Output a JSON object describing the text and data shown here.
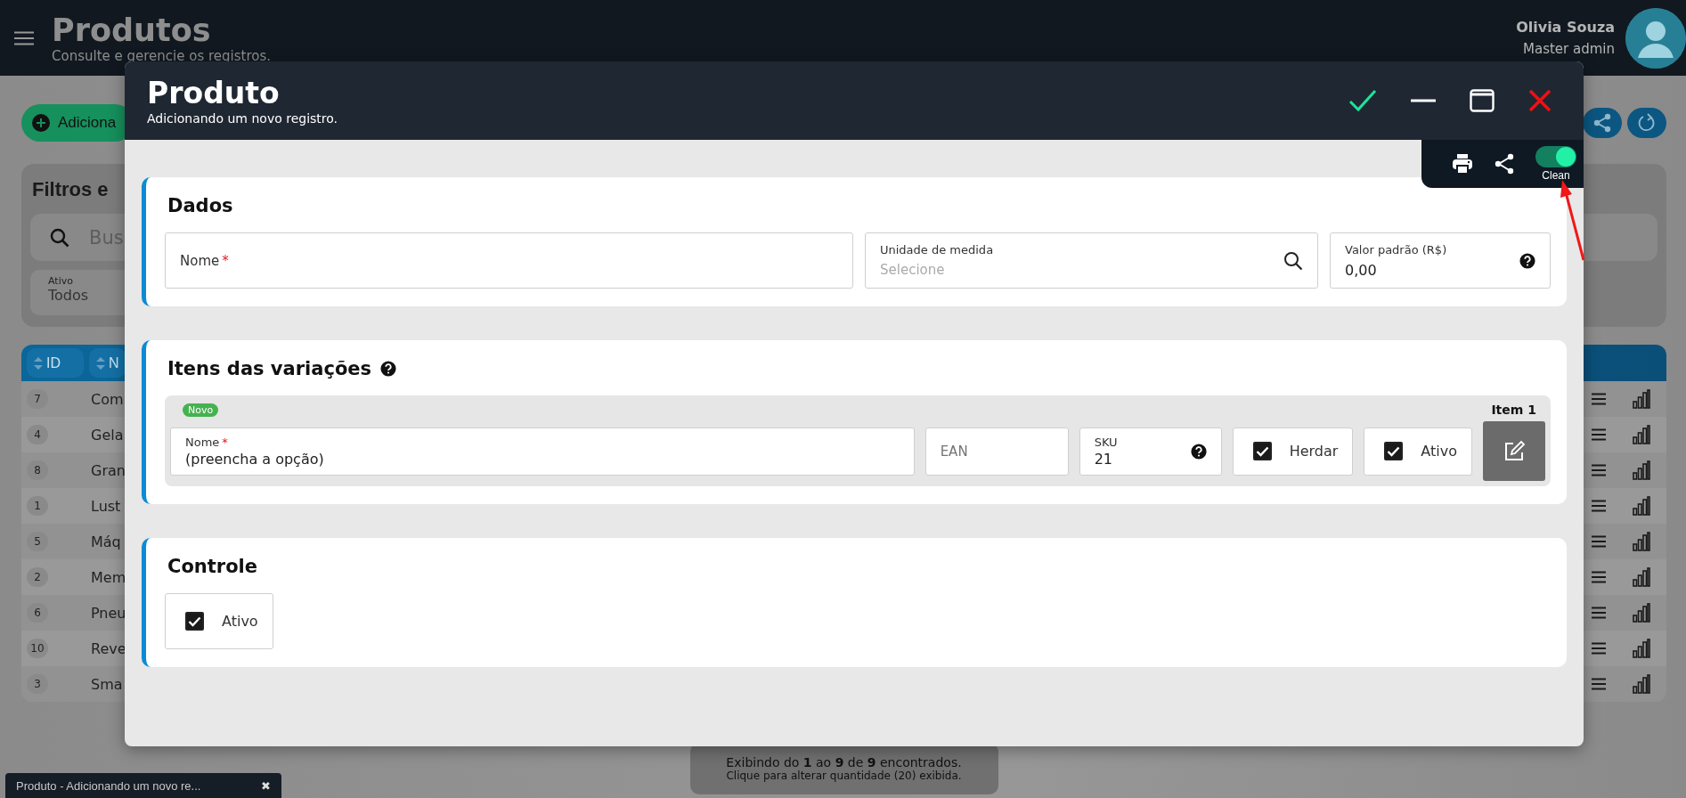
{
  "header": {
    "title": "Produtos",
    "subtitle": "Consulte e gerencie os registros.",
    "user": {
      "name": "Olivia Souza",
      "role": "Master admin"
    }
  },
  "toolbar": {
    "add_button": "Adiciona"
  },
  "filters": {
    "title": "Filtros e",
    "search_placeholder": "Bus",
    "active_field": {
      "label": "Ativo",
      "value": "Todos"
    }
  },
  "table": {
    "columns": [
      "ID",
      "N"
    ],
    "rows": [
      {
        "id": "7",
        "name": "Com"
      },
      {
        "id": "4",
        "name": "Gela"
      },
      {
        "id": "8",
        "name": "Gran"
      },
      {
        "id": "1",
        "name": "Lust"
      },
      {
        "id": "5",
        "name": "Máq"
      },
      {
        "id": "2",
        "name": "Mem"
      },
      {
        "id": "6",
        "name": "Pneu"
      },
      {
        "id": "10",
        "name": "Reve"
      },
      {
        "id": "3",
        "name": "Sma"
      }
    ]
  },
  "pagination": {
    "summary": "Exibindo do **1** ao **9** de **9** encontrados.",
    "hint": "Clique para alterar quantidade (20) exibida."
  },
  "taskbar": [
    {
      "label": "Produto - Adicionando um novo re...",
      "close": "✖"
    }
  ],
  "dialog": {
    "title": "Produto",
    "subtitle": "Adicionando um novo registro.",
    "clean_toggle": {
      "label": "Clean",
      "on": true
    },
    "sections": [
      {
        "kind": "fields",
        "title": "Dados",
        "fields": [
          {
            "kind": "text",
            "label": "Nome",
            "required_mark": "*"
          },
          {
            "kind": "lookup",
            "label": "Unidade de medida",
            "placeholder": "Selecione"
          },
          {
            "kind": "help",
            "label": "Valor padrão (R$)",
            "value": "0,00"
          }
        ]
      },
      {
        "kind": "variations",
        "title": "Itens das variações",
        "items": [
          {
            "badge": "Novo",
            "label": "Item 1",
            "name": {
              "label": "Nome",
              "required_mark": "*",
              "value": "(preencha a opção)"
            },
            "ean": {
              "placeholder": "EAN"
            },
            "sku": {
              "label": "SKU",
              "value": "21"
            },
            "inherit": {
              "label": "Herdar",
              "checked": true
            },
            "active": {
              "label": "Ativo",
              "checked": true
            }
          }
        ]
      },
      {
        "kind": "checks",
        "title": "Controle",
        "checks": [
          {
            "label": "Ativo",
            "checked": true
          }
        ]
      }
    ]
  }
}
